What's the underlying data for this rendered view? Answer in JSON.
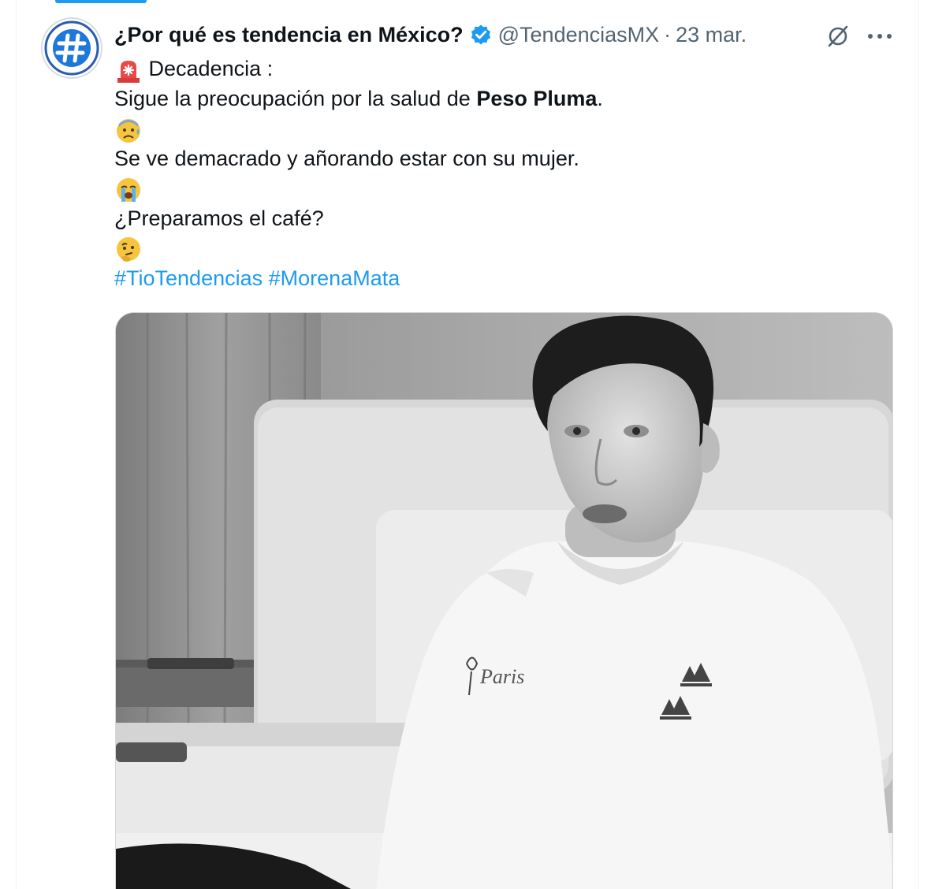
{
  "author": {
    "display_name": "¿Por qué es tendencia en México?",
    "handle": "@TendenciasMX",
    "separator": "·",
    "date": "23 mar.",
    "verified": true,
    "avatar_icon": "hashtag-logo"
  },
  "tweet": {
    "line1": "Decadencia :",
    "line1_emoji": "police-light-emoji",
    "line2_prefix": "Sigue la preocupación por la salud de ",
    "line2_bold": "Peso Pluma",
    "line2_suffix": ".",
    "line3_emoji": "anxious-sweat-emoji",
    "line4": "Se ve demacrado y añorando estar con su mujer.",
    "line5_emoji": "loudly-crying-emoji",
    "line6": "¿Preparamos el café?",
    "line7_emoji": "thinking-emoji",
    "hashtags": [
      "#TioTendencias",
      "#MorenaMata"
    ]
  },
  "media": {
    "type": "video-still",
    "shirt_text": "Paris"
  },
  "colors": {
    "accent": "#1d9bf0",
    "text": "#0f1419",
    "secondary": "#536471"
  }
}
